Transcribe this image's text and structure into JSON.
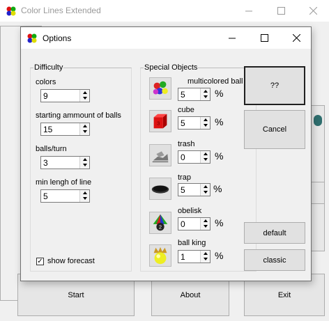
{
  "main_window": {
    "title": "Color Lines Extended",
    "buttons": {
      "start": "Start",
      "about": "About",
      "exit": "Exit"
    }
  },
  "dialog": {
    "title": "Options",
    "difficulty": {
      "legend": "Difficulty",
      "fields": [
        {
          "label": "colors",
          "value": "9"
        },
        {
          "label": "starting ammount of balls",
          "value": "15"
        },
        {
          "label": "balls/turn",
          "value": "3"
        },
        {
          "label": "min lengh of line",
          "value": "5"
        }
      ],
      "show_forecast_label": "show forecast",
      "show_forecast_checked": true
    },
    "special_objects": {
      "legend": "Special Objects",
      "percent_sign": "%",
      "items": [
        {
          "label": "multicolored ball",
          "value": "5",
          "icon": "multicolored-ball-icon"
        },
        {
          "label": "cube",
          "value": "5",
          "icon": "cube-icon"
        },
        {
          "label": "trash",
          "value": "0",
          "icon": "trash-icon"
        },
        {
          "label": "trap",
          "value": "5",
          "icon": "trap-icon"
        },
        {
          "label": "obelisk",
          "value": "0",
          "icon": "obelisk-icon"
        },
        {
          "label": "ball king",
          "value": "1",
          "icon": "ball-king-icon"
        }
      ]
    },
    "buttons": {
      "help": "??",
      "cancel": "Cancel",
      "default": "default",
      "classic": "classic"
    }
  }
}
